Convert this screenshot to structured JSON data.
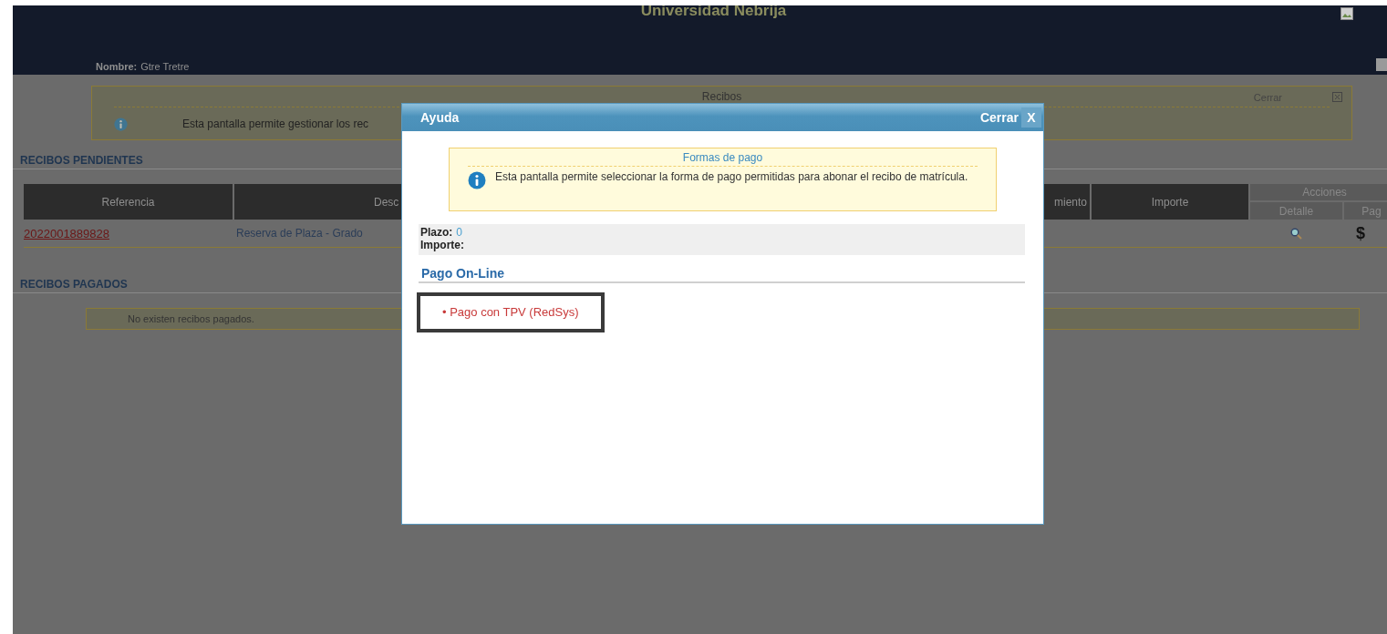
{
  "header": {
    "title": "Universidad Nebrija",
    "user_label": "Nombre:",
    "user_name": "Gtre Tretre"
  },
  "info_panel": {
    "title": "Recibos",
    "close_label": "Cerrar",
    "message": "Esta pantalla permite gestionar los rec"
  },
  "pending": {
    "heading": "RECIBOS PENDIENTES",
    "columns": [
      "Referencia",
      "Desc",
      "miento",
      "Importe"
    ],
    "actions_group": "Acciones",
    "action_columns": [
      "Detalle",
      "Pag"
    ],
    "rows": [
      {
        "reference": "2022001889828",
        "description": "Reserva de Plaza - Grado",
        "pay_symbol": "$"
      }
    ]
  },
  "paid": {
    "heading": "RECIBOS PAGADOS",
    "empty_message": "No existen recibos pagados."
  },
  "dialog": {
    "title": "Ayuda",
    "close_label": "Cerrar",
    "close_symbol": "X",
    "notice": {
      "title": "Formas de pago",
      "message": "Esta pantalla permite seleccionar la forma de pago permitidas para abonar el recibo de matrícula."
    },
    "fields": [
      {
        "label": "Plazo:",
        "value": "0"
      },
      {
        "label": "Importe:"
      }
    ],
    "section": "Pago On-Line",
    "methods": [
      {
        "label": "• Pago con TPV (RedSys)",
        "highlighted": true
      }
    ]
  }
}
